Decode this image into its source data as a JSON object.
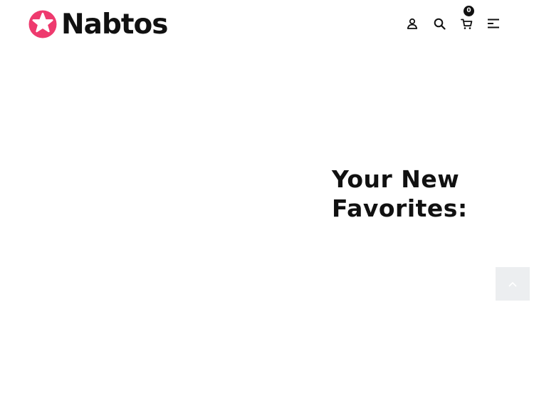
{
  "header": {
    "logo_text": "Nabtos",
    "logo_icon": "star-in-circle-icon",
    "cart_count": "0",
    "icons": [
      "user-icon",
      "search-icon",
      "cart-icon",
      "menu-icon"
    ]
  },
  "hero": {
    "title_line1": "Your New",
    "title_line2": "Favorites:"
  },
  "scroll_top": {
    "icon": "chevron-up-icon"
  },
  "colors": {
    "brand": "#ee3a6e",
    "text": "#111111",
    "scroll_bg": "#eceef0"
  }
}
